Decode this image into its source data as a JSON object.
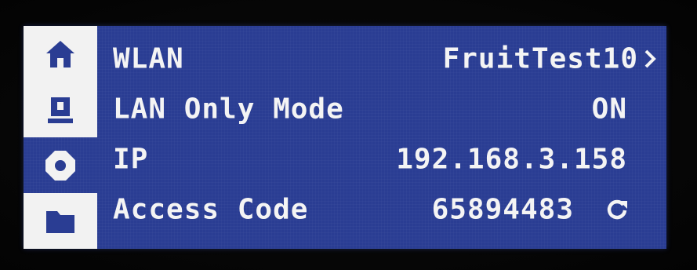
{
  "sidebar": {
    "items": [
      {
        "name": "home",
        "icon": "home-icon",
        "active": true
      },
      {
        "name": "printer",
        "icon": "print-icon",
        "active": true
      },
      {
        "name": "settings",
        "icon": "gear-icon",
        "active": false
      },
      {
        "name": "files",
        "icon": "folder-icon",
        "active": true
      }
    ]
  },
  "network": {
    "wlan_label": "WLAN",
    "wlan_value": "FruitTest10",
    "lan_only_label": "LAN Only Mode",
    "lan_only_value": "ON",
    "ip_label": "IP",
    "ip_value": "192.168.3.158",
    "access_code_label": "Access Code",
    "access_code_value": "65894483"
  },
  "colors": {
    "screen_bg": "#2a3d93",
    "text": "#f4f4f4",
    "active_tab_bg": "#f2f2f2",
    "icon_dark": "#2a3d93"
  }
}
